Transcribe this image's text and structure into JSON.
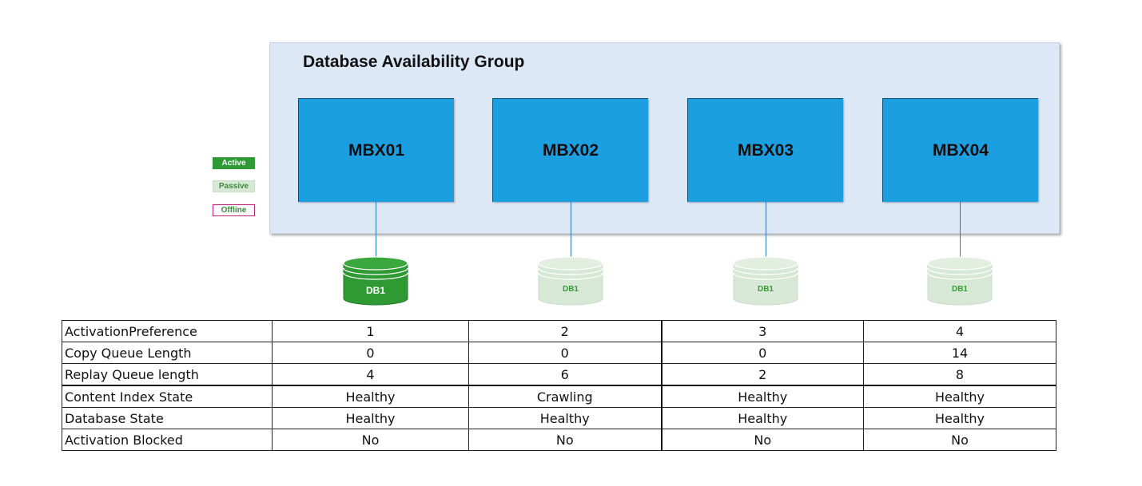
{
  "dag": {
    "title": "Database Availability Group"
  },
  "legend": {
    "active": "Active",
    "passive": "Passive",
    "offline": "Offline"
  },
  "servers": [
    {
      "name": "MBX01",
      "db_label": "DB1",
      "db_state": "active"
    },
    {
      "name": "MBX02",
      "db_label": "DB1",
      "db_state": "passive"
    },
    {
      "name": "MBX03",
      "db_label": "DB1",
      "db_state": "passive"
    },
    {
      "name": "MBX04",
      "db_label": "DB1",
      "db_state": "passive"
    }
  ],
  "colors": {
    "panel": "#dde8f6",
    "server": "#1c9fe0",
    "active_db": "#2f9a33",
    "passive_db": "#d8e8d6",
    "offline_border": "#c0247a",
    "connector": "#2a7ab8"
  },
  "table": {
    "rows": [
      {
        "label": "ActivationPreference",
        "values": [
          "1",
          "2",
          "3",
          "4"
        ]
      },
      {
        "label": "Copy Queue Length",
        "values": [
          "0",
          "0",
          "0",
          "14"
        ]
      },
      {
        "label": "Replay Queue length",
        "values": [
          "4",
          "6",
          "2",
          "8"
        ]
      },
      {
        "label": "Content Index State",
        "values": [
          "Healthy",
          "Crawling",
          "Healthy",
          "Healthy"
        ]
      },
      {
        "label": "Database State",
        "values": [
          "Healthy",
          "Healthy",
          "Healthy",
          "Healthy"
        ]
      },
      {
        "label": "Activation Blocked",
        "values": [
          "No",
          "No",
          "No",
          "No"
        ]
      }
    ]
  }
}
